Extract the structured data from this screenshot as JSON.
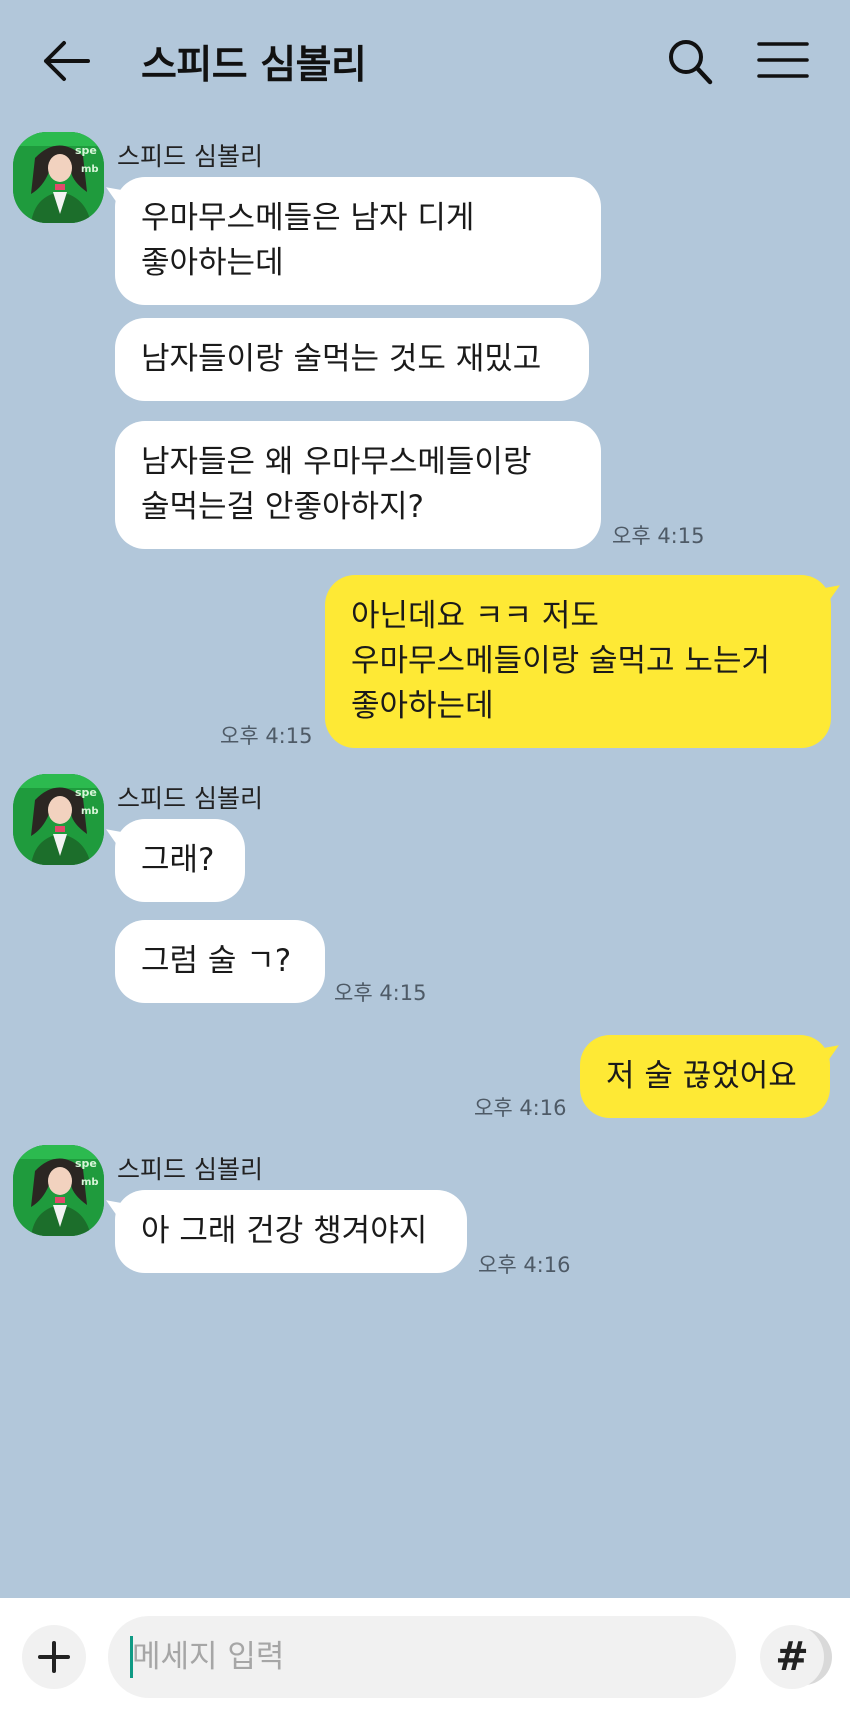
{
  "header": {
    "title": "스피드 심볼리"
  },
  "messages": [
    {
      "sender": "스피드 심볼리",
      "text": "우마무스메들은 남자 디게\n좋아하는데"
    },
    {
      "text": "남자들이랑 술먹는 것도 재밌고"
    },
    {
      "text": "남자들은 왜 우마무스메들이랑\n술먹는걸 안좋아하지?",
      "time": "오후 4:15"
    },
    {
      "text": "아닌데요 ㅋㅋ 저도\n우마무스메들이랑 술먹고 노는거\n좋아하는데",
      "time": "오후 4:15"
    },
    {
      "sender": "스피드 심볼리",
      "text": "그래?"
    },
    {
      "text": "그럼 술 ㄱ?",
      "time": "오후 4:15"
    },
    {
      "text": "저 술 끊었어요",
      "time": "오후 4:16"
    },
    {
      "sender": "스피드 심볼리",
      "text": "아 그래 건강 챙겨야지",
      "time": "오후 4:16"
    }
  ],
  "composer": {
    "placeholder": "메세지 입력",
    "hash_label": "#"
  },
  "colors": {
    "background": "#b2c7da",
    "incoming_bubble": "#ffffff",
    "outgoing_bubble": "#fee935"
  }
}
